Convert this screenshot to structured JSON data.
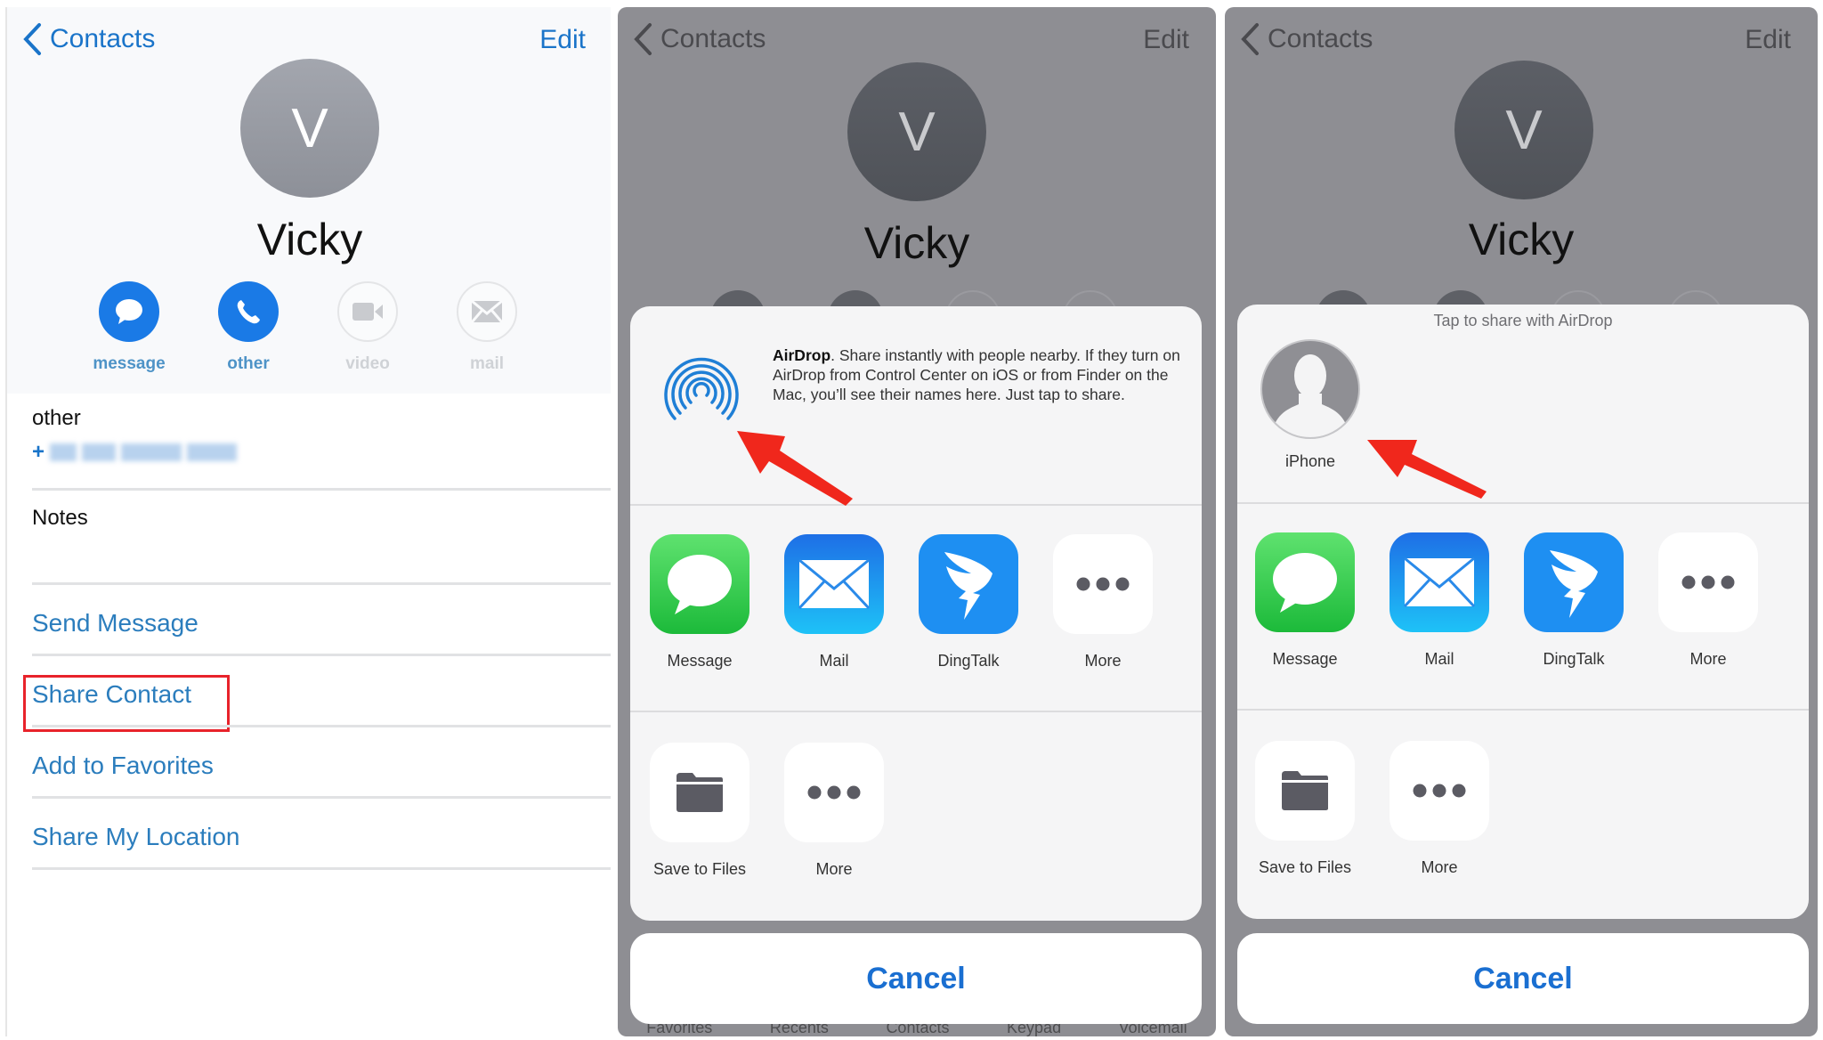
{
  "colors": {
    "accent": "#1a74c9",
    "highlight": "#e8232b",
    "arrow": "#f0271c"
  },
  "screen1": {
    "nav": {
      "back_label": "Contacts",
      "edit_label": "Edit"
    },
    "contact": {
      "initial": "V",
      "name": "Vicky"
    },
    "actions": [
      {
        "label": "message",
        "icon": "message-bubble-icon",
        "enabled": true
      },
      {
        "label": "other",
        "icon": "phone-icon",
        "enabled": true
      },
      {
        "label": "video",
        "icon": "video-camera-icon",
        "enabled": false
      },
      {
        "label": "mail",
        "icon": "envelope-icon",
        "enabled": false
      }
    ],
    "phone": {
      "label": "other",
      "prefix": "+",
      "value_blurred": true
    },
    "notes_label": "Notes",
    "links": [
      "Send Message",
      "Share Contact",
      "Add to Favorites",
      "Share My Location"
    ],
    "highlighted_link": "Share Contact"
  },
  "screen2": {
    "nav": {
      "back_label": "Contacts",
      "edit_label": "Edit"
    },
    "contact": {
      "initial": "V",
      "name": "Vicky"
    },
    "airdrop": {
      "title": "AirDrop",
      "description": ". Share instantly with people nearby. If they turn on AirDrop from Control Center on iOS or from Finder on the Mac, you’ll see their names here. Just tap to share."
    },
    "apps": [
      "Message",
      "Mail",
      "DingTalk",
      "More"
    ],
    "actions": [
      "Save to Files",
      "More"
    ],
    "cancel_label": "Cancel",
    "tabbar": [
      "Favorites",
      "Recents",
      "Contacts",
      "Keypad",
      "Voicemail"
    ]
  },
  "screen3": {
    "nav": {
      "back_label": "Contacts",
      "edit_label": "Edit"
    },
    "contact": {
      "initial": "V",
      "name": "Vicky"
    },
    "airdrop_hint": "Tap to share with AirDrop",
    "device": {
      "name": "iPhone"
    },
    "apps": [
      "Message",
      "Mail",
      "DingTalk",
      "More"
    ],
    "actions": [
      "Save to Files",
      "More"
    ],
    "cancel_label": "Cancel"
  }
}
